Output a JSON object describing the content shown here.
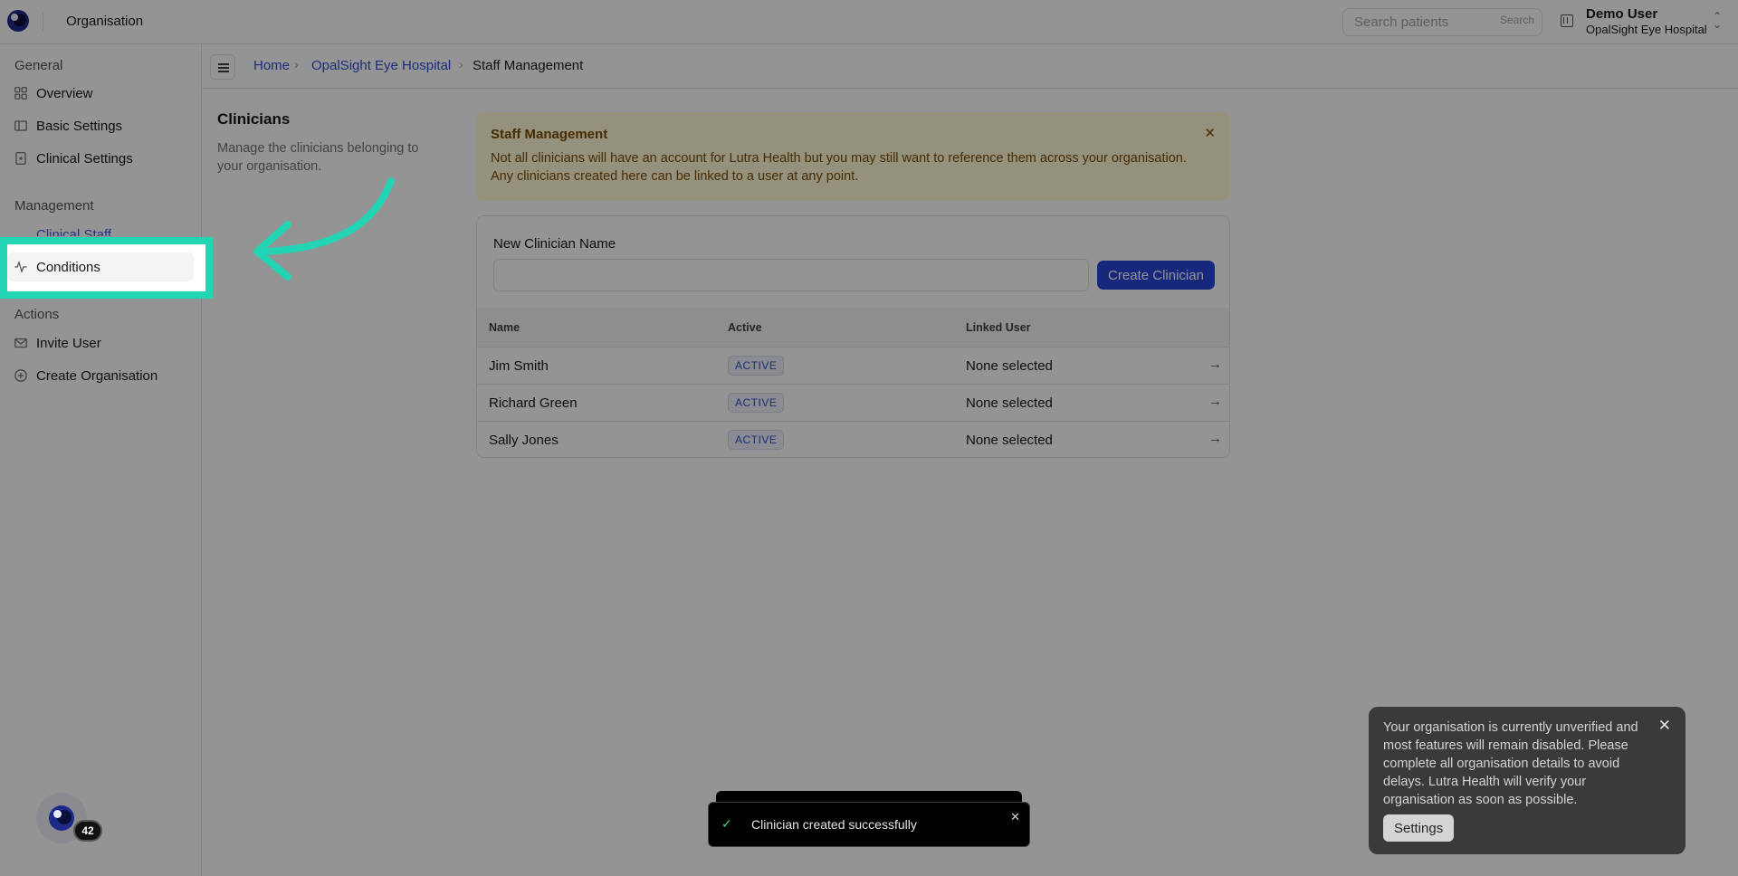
{
  "topbar": {
    "title": "Organisation",
    "search_placeholder": "Search patients",
    "search_button": "Search",
    "user_name": "Demo User",
    "user_org": "OpalSight Eye Hospital"
  },
  "sidebar": {
    "general_label": "General",
    "management_label": "Management",
    "actions_label": "Actions",
    "items": {
      "overview": "Overview",
      "basic_settings": "Basic Settings",
      "clinical_settings": "Clinical Settings",
      "clinical_staff": "Clinical Staff",
      "conditions": "Conditions",
      "invite_user": "Invite User",
      "create_organisation": "Create Organisation"
    }
  },
  "breadcrumb": {
    "home": "Home",
    "org": "OpalSight Eye Hospital",
    "current": "Staff Management"
  },
  "page": {
    "title": "Clinicians",
    "description": "Manage the clinicians belonging to your organisation."
  },
  "alert": {
    "title": "Staff Management",
    "body_line1": "Not all clinicians will have an account for Lutra Health but you may still want to reference them across your organisation.",
    "body_line2": "Any clinicians created here can be linked to a user at any point."
  },
  "form": {
    "label": "New Clinician Name",
    "value": "",
    "button": "Create Clinician"
  },
  "table": {
    "headers": [
      "Name",
      "Active",
      "Linked User"
    ],
    "rows": [
      {
        "name": "Jim Smith",
        "status": "ACTIVE",
        "linked": "None selected"
      },
      {
        "name": "Richard Green",
        "status": "ACTIVE",
        "linked": "None selected"
      },
      {
        "name": "Sally Jones",
        "status": "ACTIVE",
        "linked": "None selected"
      }
    ]
  },
  "toast": {
    "message": "Clinician created successfully"
  },
  "notice": {
    "text": "Your organisation is currently unverified and most features will remain disabled. Please complete all organisation details to avoid delays. Lutra Health will verify your organisation as soon as possible.",
    "button": "Settings"
  },
  "assistant": {
    "badge": "42"
  },
  "colors": {
    "accent": "#2746d6",
    "highlight": "#22d3b4",
    "link": "#2f4fd0"
  }
}
